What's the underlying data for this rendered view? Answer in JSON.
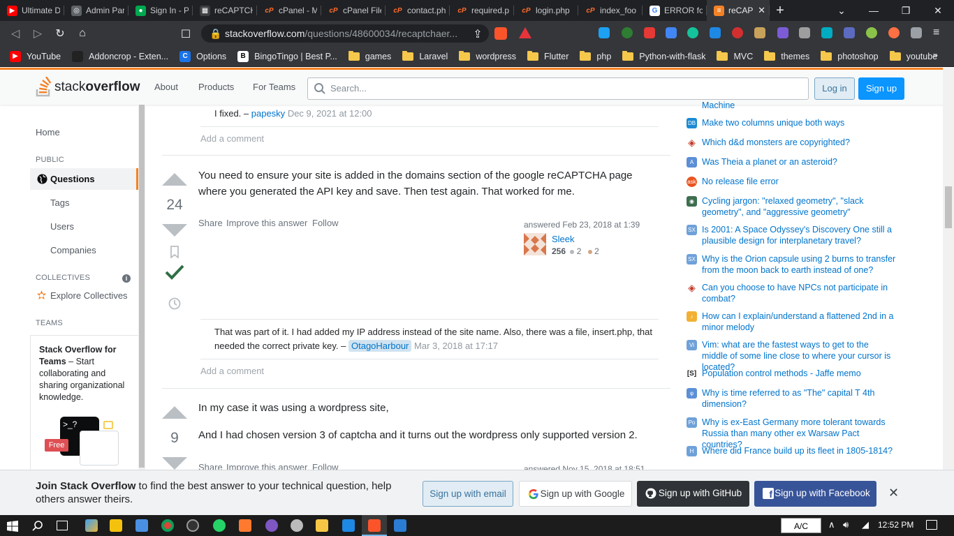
{
  "browser": {
    "tabs": [
      {
        "label": "Ultimate D",
        "fav_color": "#ff0000",
        "fav_glyph": "▶"
      },
      {
        "label": "Admin Par",
        "fav_color": "#5f6368",
        "fav_glyph": "◎"
      },
      {
        "label": "Sign In - P",
        "fav_color": "#00a84f",
        "fav_glyph": "●"
      },
      {
        "label": "reCAPTCH",
        "fav_color": "#3c4043",
        "fav_glyph": "▦"
      },
      {
        "label": "cPanel - M",
        "fav_color": "#ff6c2c",
        "fav_glyph": "cP"
      },
      {
        "label": "cPanel File",
        "fav_color": "#ff6c2c",
        "fav_glyph": "cP"
      },
      {
        "label": "contact.ph",
        "fav_color": "#ff6c2c",
        "fav_glyph": "cP"
      },
      {
        "label": "required.p",
        "fav_color": "#ff6c2c",
        "fav_glyph": "cP"
      },
      {
        "label": "login.php",
        "fav_color": "#ff6c2c",
        "fav_glyph": "cP"
      },
      {
        "label": "index_foo",
        "fav_color": "#ff6c2c",
        "fav_glyph": "cP"
      },
      {
        "label": "ERROR for",
        "fav_color": "#ffffff",
        "fav_glyph": "G"
      },
      {
        "label": "reCAP",
        "fav_color": "#f48225",
        "fav_glyph": "≡",
        "active": true
      }
    ],
    "url_host": "stackoverflow.com",
    "url_path": "/questions/48600034/recaptchaer...",
    "bookmarks": [
      {
        "label": "YouTube",
        "kind": "youtube-icon"
      },
      {
        "label": "Addoncrop - Exten...",
        "kind": "addoncrop-icon"
      },
      {
        "label": "Options",
        "kind": "options-icon"
      },
      {
        "label": "BingoTingo | Best P...",
        "kind": "bingotingo-icon"
      },
      {
        "label": "games",
        "kind": "folder"
      },
      {
        "label": "Laravel",
        "kind": "folder"
      },
      {
        "label": "wordpress",
        "kind": "folder"
      },
      {
        "label": "Flutter",
        "kind": "folder"
      },
      {
        "label": "php",
        "kind": "folder"
      },
      {
        "label": "Python-with-flask",
        "kind": "folder"
      },
      {
        "label": "MVC",
        "kind": "folder"
      },
      {
        "label": "themes",
        "kind": "folder"
      },
      {
        "label": "photoshop",
        "kind": "folder"
      },
      {
        "label": "youtube",
        "kind": "folder"
      }
    ],
    "more_bookmarks": "»"
  },
  "so": {
    "logo_stack": "stack",
    "logo_overflow": "overflow",
    "nav": {
      "about": "About",
      "products": "Products",
      "for_teams": "For Teams"
    },
    "search_placeholder": "Search...",
    "login": "Log in",
    "signup": "Sign up"
  },
  "sidebar": {
    "home": "Home",
    "public_caption": "PUBLIC",
    "questions": "Questions",
    "tags": "Tags",
    "users": "Users",
    "companies": "Companies",
    "collectives_caption": "COLLECTIVES",
    "explore_collectives": "Explore Collectives",
    "teams_caption": "TEAMS",
    "teams_title": "Stack Overflow for Teams",
    "teams_text": " – Start collaborating and sharing organizational knowledge.",
    "free_badge": "Free"
  },
  "prev_comment": {
    "text": "I fixed. –",
    "user": "papesky",
    "date": "Dec 9, 2021 at 12:00",
    "add_comment": "Add a comment"
  },
  "answer1": {
    "score": "24",
    "body": "You need to ensure your site is added in the domains section of the google reCAPTCHA page where you generated the API key and save. Then test again. That worked for me.",
    "share": "Share",
    "improve": "Improve this answer",
    "follow": "Follow",
    "answered": "answered Feb 23, 2018 at 1:39",
    "user": "Sleek",
    "rep": "256",
    "silver": "2",
    "bronze": "2",
    "comment_text": "That was part of it. I had added my IP address instead of the site name. Also, there was a file, insert.php, that needed the correct private key. –",
    "comment_user": "OtagoHarbour",
    "comment_date": "Mar 3, 2018 at 17:17",
    "add_comment": "Add a comment"
  },
  "answer2": {
    "score": "9",
    "para1": "In my case it was using a wordpress site,",
    "para2": "And I had chosen version 3 of captcha and it turns out the wordpress only supported version 2.",
    "share": "Share",
    "improve": "Improve this answer",
    "follow": "Follow",
    "answered": "answered Nov 15, 2018 at 18:51"
  },
  "hot_questions": [
    {
      "text": "Machine",
      "icon": "stackexchange-icon",
      "color": "#0077cc"
    },
    {
      "text": "Make two columns unique both ways",
      "icon": "database-icon",
      "color": "#1a8ad4"
    },
    {
      "text": "Which d&d monsters are copyrighted?",
      "icon": "rpg-icon",
      "color": "#c0392b"
    },
    {
      "text": "Was Theia a planet or an asteroid?",
      "icon": "astronomy-icon",
      "color": "#5b8fd6"
    },
    {
      "text": "No release file error",
      "icon": "askubuntu-icon",
      "color": "#e95420"
    },
    {
      "text": "Cycling jargon: \"relaxed geometry\", \"slack geometry\", and \"aggressive geometry\"",
      "icon": "bicycles-icon",
      "color": "#3d6e4f"
    },
    {
      "text": "Is 2001: A Space Odyssey's Discovery One still a plausible design for interplanetary travel?",
      "icon": "scifi-icon",
      "color": "#6fa1d9"
    },
    {
      "text": "Why is the Orion capsule using 2 burns to transfer from the moon back to earth instead of one?",
      "icon": "space-icon",
      "color": "#6fa1d9"
    },
    {
      "text": "Can you choose to have NPCs not participate in combat?",
      "icon": "rpg-icon",
      "color": "#c0392b"
    },
    {
      "text": "How can I explain/understand a flattened 2nd in a minor melody",
      "icon": "music-icon",
      "color": "#f2b134"
    },
    {
      "text": "Vim: what are the fastest ways to get to the middle of some line close to where your cursor is located?",
      "icon": "vi-icon",
      "color": "#6fa1d9"
    },
    {
      "text": "Population control methods - Jaffe memo",
      "icon": "skeptics-icon",
      "color": "#222222"
    },
    {
      "text": "Why is time referred to as \"The\" capital T 4th dimension?",
      "icon": "physics-icon",
      "color": "#5b8fd6"
    },
    {
      "text": "Why is ex-East Germany more tolerant towards Russia than many other ex Warsaw Pact countries?",
      "icon": "politics-icon",
      "color": "#6fa1d9"
    },
    {
      "text": "Where did France build up its fleet in 1805-1814?",
      "icon": "history-icon",
      "color": "#6fa1d9"
    }
  ],
  "banner": {
    "lead": "Join Stack Overflow",
    "rest": " to find the best answer to your technical question, help others answer theirs.",
    "email": "Sign up with email",
    "google": "Sign up with Google",
    "github": "Sign up with GitHub",
    "facebook": "Sign up with Facebook"
  },
  "taskbar": {
    "ac": "A/C",
    "time": "12:52 PM"
  }
}
